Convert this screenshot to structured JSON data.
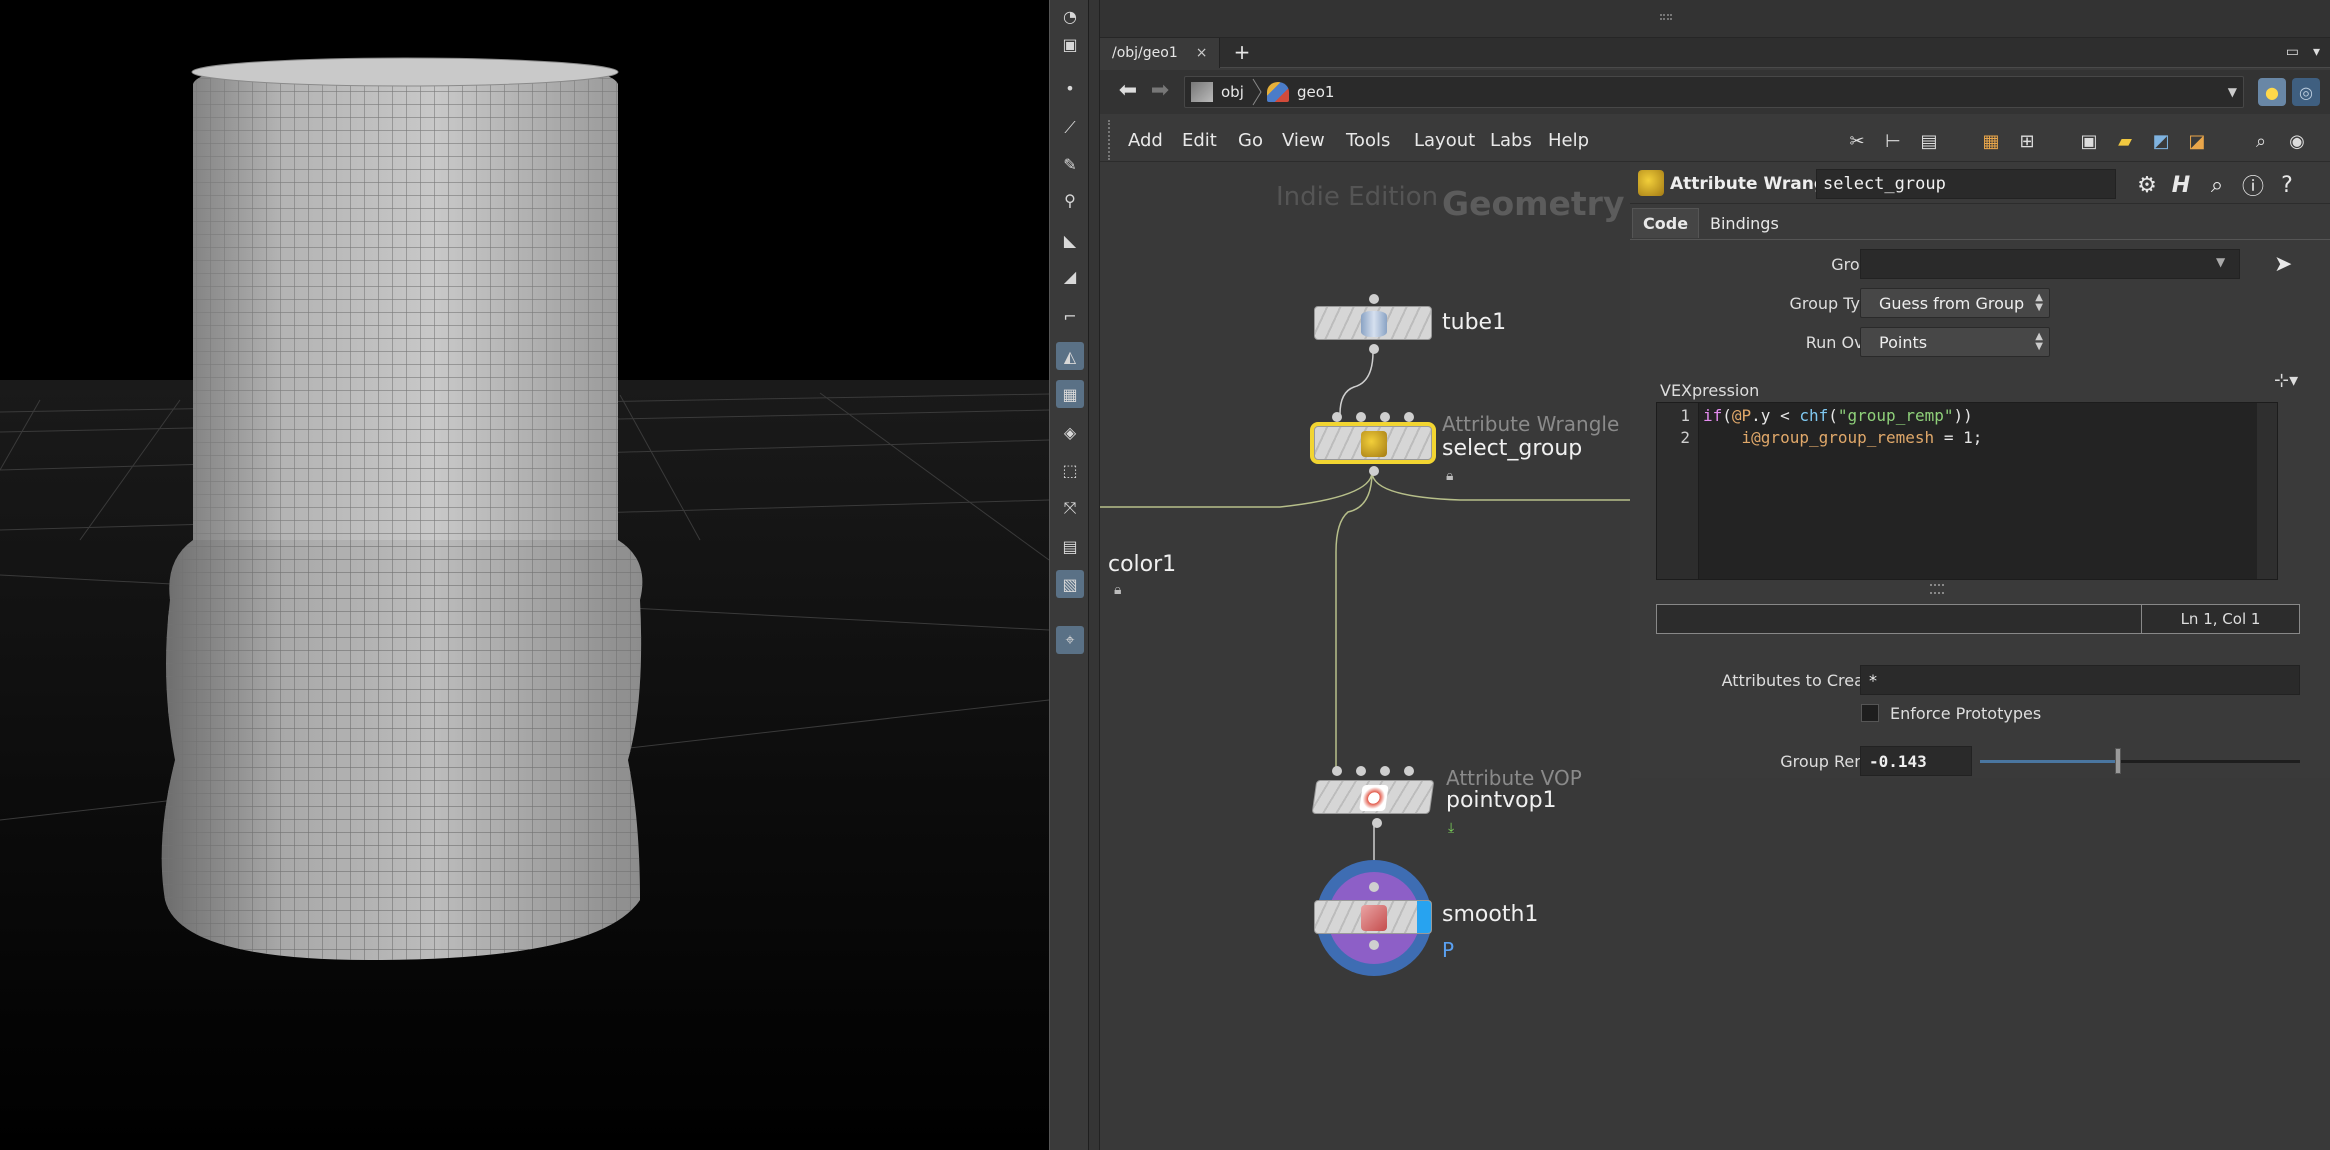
{
  "viewport": {
    "background": "#000000"
  },
  "tabbar": {
    "tab_label": "/obj/geo1",
    "close_label": "×",
    "add_label": "+"
  },
  "pathbar": {
    "crumbs": [
      "obj",
      "geo1"
    ]
  },
  "menubar": {
    "items": [
      "Add",
      "Edit",
      "Go",
      "View",
      "Tools",
      "Layout",
      "Labs",
      "Help"
    ]
  },
  "network": {
    "edition_label": "Indie Edition",
    "context_label": "Geometry",
    "nodes": {
      "tube": {
        "name": "tube1"
      },
      "wrangle": {
        "type": "Attribute Wrangle",
        "name": "select_group"
      },
      "color": {
        "name": "color1"
      },
      "vop": {
        "type": "Attribute VOP",
        "name": "pointvop1"
      },
      "smooth": {
        "name": "smooth1",
        "flag_label": "P"
      }
    }
  },
  "params": {
    "node_type": "Attribute Wrangle",
    "node_name": "select_group",
    "tabs": [
      "Code",
      "Bindings"
    ],
    "group_label": "Group",
    "group_value": "",
    "group_type_label": "Group Type",
    "group_type_value": "Guess from Group",
    "run_over_label": "Run Over",
    "run_over_value": "Points",
    "vex_label": "VEXpression",
    "code_lines": [
      "1",
      "2"
    ],
    "code": {
      "l1_if": "if",
      "l1_open": "(",
      "l1_attr": "@P",
      "l1_rest": ".y < ",
      "l1_fn": "chf",
      "l1_paren": "(",
      "l1_str": "\"group_remp\"",
      "l1_close": "))",
      "l2_indent": "    ",
      "l2_attr": "i@group_group_remesh",
      "l2_rest": " = 1;"
    },
    "cursor_pos": "Ln 1, Col 1",
    "attrs_label": "Attributes to Create",
    "attrs_value": "*",
    "enforce_label": "Enforce Prototypes",
    "remp_label": "Group Remp",
    "remp_value": "-0.143",
    "remp_fraction": 0.43
  },
  "colors": {
    "selected_node": "#f2d531",
    "accent_blue": "#4a76a0",
    "display_ring": "#3e6db3",
    "render_ring": "#8d5fc7"
  }
}
